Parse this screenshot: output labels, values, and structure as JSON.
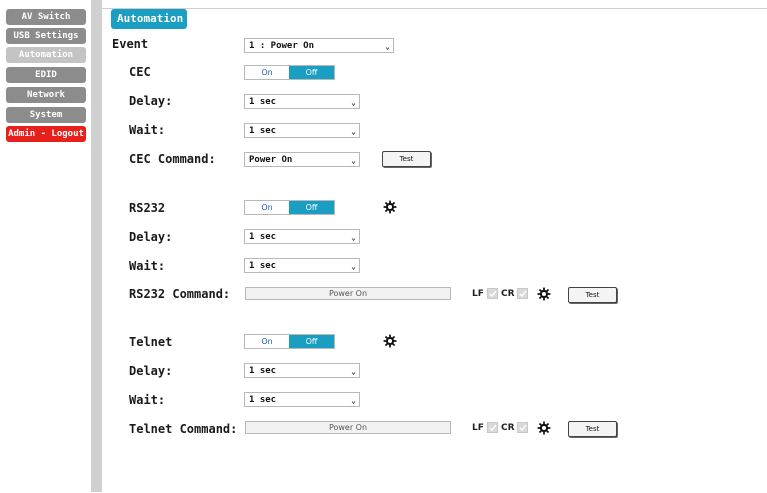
{
  "sidebar": {
    "items": [
      {
        "label": "AV Switch"
      },
      {
        "label": "USB Settings"
      },
      {
        "label": "Automation"
      },
      {
        "label": "EDID"
      },
      {
        "label": "Network"
      },
      {
        "label": "System"
      },
      {
        "label": "Admin - Logout"
      }
    ]
  },
  "tab": {
    "label": "Automation"
  },
  "event": {
    "label": "Event",
    "value": "1 : Power On"
  },
  "cec": {
    "label": "CEC",
    "toggle_on": "On",
    "toggle_off": "Off",
    "delay_label": "Delay:",
    "delay_value": "1 sec",
    "wait_label": "Wait:",
    "wait_value": "1 sec",
    "command_label": "CEC Command:",
    "command_value": "Power On",
    "test_label": "Test"
  },
  "rs232": {
    "label": "RS232",
    "toggle_on": "On",
    "toggle_off": "Off",
    "delay_label": "Delay:",
    "delay_value": "1 sec",
    "wait_label": "Wait:",
    "wait_value": "1 sec",
    "command_label": "RS232 Command:",
    "command_value": "Power On",
    "lf_label": "LF",
    "cr_label": "CR",
    "test_label": "Test"
  },
  "telnet": {
    "label": "Telnet",
    "toggle_on": "On",
    "toggle_off": "Off",
    "delay_label": "Delay:",
    "delay_value": "1 sec",
    "wait_label": "Wait:",
    "wait_value": "1 sec",
    "command_label": "Telnet Command:",
    "command_value": "Power On",
    "lf_label": "LF",
    "cr_label": "CR",
    "test_label": "Test"
  },
  "colors": {
    "accent": "#1a9fc2",
    "nav": "#8c8c8c",
    "logout": "#e8201c"
  },
  "icons": {
    "settings": "gear-icon",
    "dropdown": "chevron-down-icon",
    "check": "check-icon"
  }
}
